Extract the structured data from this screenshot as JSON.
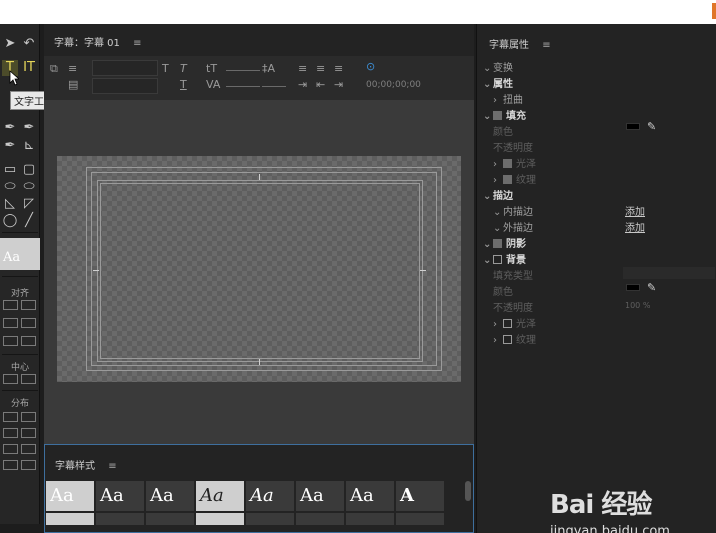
{
  "editor": {
    "title": "字幕：字幕 01",
    "menu_icon": "≡",
    "timecode": "00;00;00;00"
  },
  "tools": {
    "tooltip": "文字工具",
    "style_preview": "Aa",
    "align_label": "对齐",
    "center_label": "中心",
    "distribute_label": "分布"
  },
  "styles": {
    "title": "字幕样式",
    "menu_icon": "≡",
    "swatches": [
      "Aa",
      "Aa",
      "Aa",
      "Aa",
      "Aa",
      "Aa",
      "Aa",
      "A"
    ]
  },
  "props": {
    "title": "字幕属性",
    "menu_icon": "≡",
    "transform": "变换",
    "attributes": "属性",
    "distort": "扭曲",
    "fill": "填充",
    "color": "颜色",
    "opacity": "不透明度",
    "sheen": "光泽",
    "texture": "纹理",
    "stroke": "描边",
    "inner_stroke": "内描边",
    "outer_stroke": "外描边",
    "add": "添加",
    "shadow": "阴影",
    "background": "背景",
    "fill_type": "填充类型",
    "bg_color": "颜色",
    "bg_opacity": "不透明度",
    "bg_opacity_value": "100 %",
    "bg_sheen": "光泽",
    "bg_texture": "纹理"
  },
  "watermark": {
    "brand": "Bai 经验",
    "url": "jingyan.baidu.com"
  },
  "colors": {
    "accent": "#e0762a",
    "panel_border_blue": "#3e6f9e",
    "selected_tool": "#e6d65a"
  }
}
